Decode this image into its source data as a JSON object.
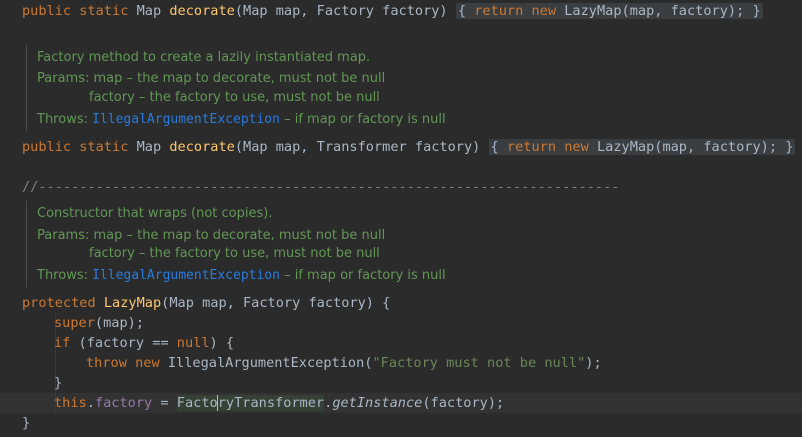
{
  "code": {
    "line1": {
      "kw1": "public static",
      "type": "Map",
      "method": "decorate",
      "params": "(Map map, Factory factory)",
      "fold": "{ return new LazyMap(map, factory); }",
      "fold_open": "{",
      "fold_ret": "return",
      "fold_new": "new",
      "fold_body": "LazyMap(map, factory);",
      "fold_close": "}"
    },
    "doc1": {
      "summary": "Factory method to create a lazily instantiated map.",
      "params_label": "Params:",
      "param1": "map – the map to decorate, must not be null",
      "param2": "factory – the factory to use, must not be null",
      "throws_label": "Throws:",
      "throws_link": "IllegalArgumentException",
      "throws_text": " – if map or factory is null"
    },
    "line2": {
      "kw1": "public static",
      "type": "Map",
      "method": "decorate",
      "params": "(Map map, Transformer factory)",
      "fold_open": "{",
      "fold_ret": "return",
      "fold_new": "new",
      "fold_body": "LazyMap(map, factory);",
      "fold_close": "}"
    },
    "separator": "//-----------------------------------------------------------------------",
    "doc2": {
      "summary": "Constructor that wraps (not copies).",
      "params_label": "Params:",
      "param1": "map – the map to decorate, must not be null",
      "param2": "factory – the factory to use, must not be null",
      "throws_label": "Throws:",
      "throws_link": "IllegalArgumentException",
      "throws_text": " – if map or factory is null"
    },
    "ctor": {
      "kw": "protected",
      "name": "LazyMap",
      "params": "(Map map, Factory factory) {"
    },
    "super_line": {
      "kw": "super",
      "rest": "(map);"
    },
    "if_line": {
      "kw": "if",
      "open": " (factory == ",
      "null": "null",
      "close": ") {"
    },
    "throw_line": {
      "kw1": "throw",
      "kw2": "new",
      "cls": " IllegalArgumentException(",
      "str": "\"Factory must not be null\"",
      "close": ");"
    },
    "close_if": "}",
    "this_line": {
      "kw": "this",
      "dot": ".",
      "field": "factory",
      "eq": " = ",
      "cls_a": "Facto",
      "cls_b": "ryTransformer",
      "dot2": ".",
      "method": "getInstance",
      "args": "(factory);"
    },
    "close_ctor": "}"
  }
}
